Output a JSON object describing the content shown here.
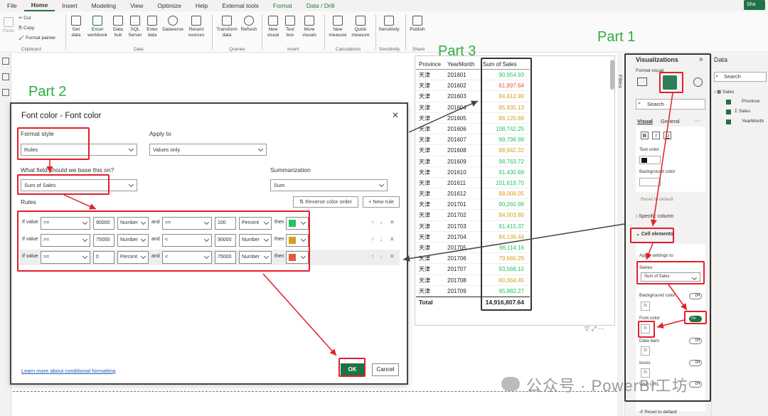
{
  "menu": {
    "items": [
      "File",
      "Home",
      "Insert",
      "Modeling",
      "View",
      "Optimize",
      "Help",
      "External tools",
      "Format",
      "Data / Drill"
    ],
    "active": "Home",
    "share_label": "Sha"
  },
  "ribbon": {
    "clipboard": {
      "paste": "Paste",
      "cut": "Cut",
      "copy": "Copy",
      "format_painter": "Format painter",
      "group": "Clipboard"
    },
    "data": {
      "get_data": "Get data",
      "excel": "Excel workbook",
      "data_hub": "Data hub",
      "sql": "SQL Server",
      "enter": "Enter data",
      "dataverse": "Dataverse",
      "recent": "Recent sources",
      "group": "Data"
    },
    "queries": {
      "transform": "Transform data",
      "refresh": "Refresh",
      "group": "Queries"
    },
    "insert": {
      "new_visual": "New visual",
      "text_box": "Text box",
      "more_visuals": "More visuals",
      "group": "Insert"
    },
    "calculations": {
      "new_measure": "New measure",
      "quick_measure": "Quick measure",
      "group": "Calculations"
    },
    "sensitivity": {
      "label": "Sensitivity",
      "group": "Sensitivity"
    },
    "share": {
      "publish": "Publish",
      "group": "Share"
    }
  },
  "parts": {
    "part1": "Part 1",
    "part2": "Part 2",
    "part3": "Part 3"
  },
  "table": {
    "headers": [
      "Province",
      "YearMonth",
      "Sum of Sales"
    ],
    "rows": [
      {
        "province": "天津",
        "ym": "201601",
        "sales": "90,954.93",
        "color": "#22c55e"
      },
      {
        "province": "天津",
        "ym": "201602",
        "sales": "61,897.64",
        "color": "#e8553a"
      },
      {
        "province": "天津",
        "ym": "201603",
        "sales": "84,412.90",
        "color": "#d4a017"
      },
      {
        "province": "天津",
        "ym": "201604",
        "sales": "85,935.13",
        "color": "#d4a017"
      },
      {
        "province": "天津",
        "ym": "201605",
        "sales": "86,120.69",
        "color": "#d4a017"
      },
      {
        "province": "天津",
        "ym": "201606",
        "sales": "108,742.25",
        "color": "#22c55e"
      },
      {
        "province": "天津",
        "ym": "201607",
        "sales": "99,796.99",
        "color": "#22c55e"
      },
      {
        "province": "天津",
        "ym": "201608",
        "sales": "88,942.32",
        "color": "#d4a017"
      },
      {
        "province": "天津",
        "ym": "201609",
        "sales": "98,763.72",
        "color": "#22c55e"
      },
      {
        "province": "天津",
        "ym": "201610",
        "sales": "91,430.69",
        "color": "#22c55e"
      },
      {
        "province": "天津",
        "ym": "201611",
        "sales": "101,619.70",
        "color": "#22c55e"
      },
      {
        "province": "天津",
        "ym": "201612",
        "sales": "88,008.05",
        "color": "#d4a017"
      },
      {
        "province": "天津",
        "ym": "201701",
        "sales": "90,260.98",
        "color": "#22c55e"
      },
      {
        "province": "天津",
        "ym": "201702",
        "sales": "84,003.80",
        "color": "#d4a017"
      },
      {
        "province": "天津",
        "ym": "201703",
        "sales": "91,415.37",
        "color": "#22c55e"
      },
      {
        "province": "天津",
        "ym": "201704",
        "sales": "84,139.44",
        "color": "#d4a017"
      },
      {
        "province": "天津",
        "ym": "201705",
        "sales": "98,114.16",
        "color": "#22c55e"
      },
      {
        "province": "天津",
        "ym": "201706",
        "sales": "79,660.29",
        "color": "#d4a017"
      },
      {
        "province": "天津",
        "ym": "201707",
        "sales": "93,568.10",
        "color": "#22c55e"
      },
      {
        "province": "天津",
        "ym": "201708",
        "sales": "80,064.45",
        "color": "#d4a017"
      },
      {
        "province": "天津",
        "ym": "201709",
        "sales": "95,882.27",
        "color": "#22c55e"
      }
    ],
    "total_label": "Total",
    "total_value": "14,916,807.64"
  },
  "dialog": {
    "title": "Font color - Font color",
    "format_style_label": "Format style",
    "format_style_value": "Rules",
    "apply_to_label": "Apply to",
    "apply_to_value": "Values only",
    "field_label": "What field should we base this on?",
    "field_value": "Sum of Sales",
    "summarization_label": "Summarization",
    "summarization_value": "Sum",
    "rules_label": "Rules",
    "reverse_label": "⇅ Reverse color order",
    "new_rule_label": "+ New rule",
    "rules": [
      {
        "if": "If value",
        "op1": ">=",
        "v1": "90000",
        "t1": "Number",
        "and": "and",
        "op2": "<=",
        "v2": "100",
        "t2": "Percent",
        "then": "then",
        "color": "#22c55e"
      },
      {
        "if": "If value",
        "op1": ">=",
        "v1": "75000",
        "t1": "Number",
        "and": "and",
        "op2": "<",
        "v2": "90000",
        "t2": "Number",
        "then": "then",
        "color": "#d4a017"
      },
      {
        "if": "If value",
        "op1": ">=",
        "v1": "0",
        "t1": "Percent",
        "and": "and",
        "op2": "<",
        "v2": "75000",
        "t2": "Number",
        "then": "then",
        "color": "#e8553a"
      }
    ],
    "learn_link": "Learn more about conditional formatting",
    "ok": "OK",
    "cancel": "Cancel"
  },
  "viz": {
    "title": "Visualizations",
    "format_visual": "Format visual",
    "search_placeholder": "Search",
    "tab_visual": "Visual",
    "tab_general": "General",
    "more": "···",
    "bold": "B",
    "italic": "I",
    "underline": "U",
    "text_color": "Text color",
    "background_color": "Background color",
    "reset": "Reset to default",
    "specific_column": "Specific column",
    "cell_elements": "Cell elements",
    "apply_settings": "Apply settings to",
    "series_label": "Series",
    "series_value": "Sum of Sales",
    "bg_color": "Background color",
    "bg_toggle": "Off",
    "font_color": "Font color",
    "font_toggle": "On",
    "data_bars": "Data bars",
    "data_bars_toggle": "Off",
    "icons": "Icons",
    "icons_toggle": "Off",
    "web_url": "Web URL",
    "web_toggle": "Off",
    "reset_bottom": "Reset to default",
    "fx": "fx"
  },
  "filters_label": "Filters",
  "datapane": {
    "title": "Data",
    "search_placeholder": "Search",
    "table": "Sales",
    "fields": [
      "Province",
      "Σ Sales",
      "YearMonth"
    ]
  },
  "watermark": "公众号 · PowerBI工坊"
}
